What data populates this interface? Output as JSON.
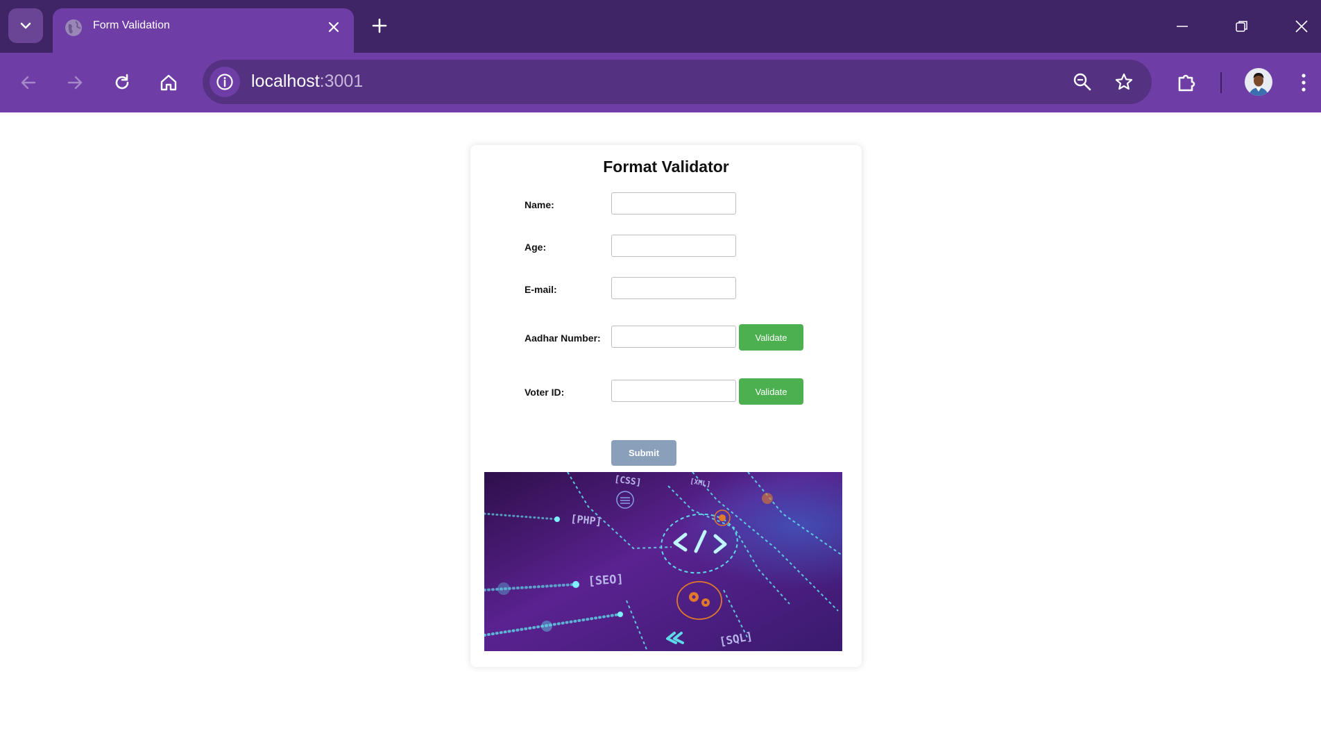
{
  "browser": {
    "tab_title": "Form Validation",
    "url_host": "localhost",
    "url_port": ":3001"
  },
  "form": {
    "title": "Format Validator",
    "fields": [
      {
        "label": "Name:",
        "value": ""
      },
      {
        "label": "Age:",
        "value": ""
      },
      {
        "label": "E-mail:",
        "value": ""
      },
      {
        "label": "Aadhar Number:",
        "value": "",
        "button": "Validate"
      },
      {
        "label": "Voter ID:",
        "value": "",
        "button": "Validate"
      }
    ],
    "submit_label": "Submit"
  },
  "banner": {
    "tags": [
      "[CSS]",
      "[XML]",
      "[PHP]",
      "[SEO]",
      "[SQL]",
      "</>"
    ]
  },
  "colors": {
    "tabstrip": "#3f2566",
    "toolbar": "#6e3ea6",
    "validate_button": "#4caf50",
    "submit_button": "#8aa0ba",
    "banner_bg": "#3e1460",
    "banner_accent": "#5fd8e8",
    "banner_orange": "#e07a2a"
  }
}
